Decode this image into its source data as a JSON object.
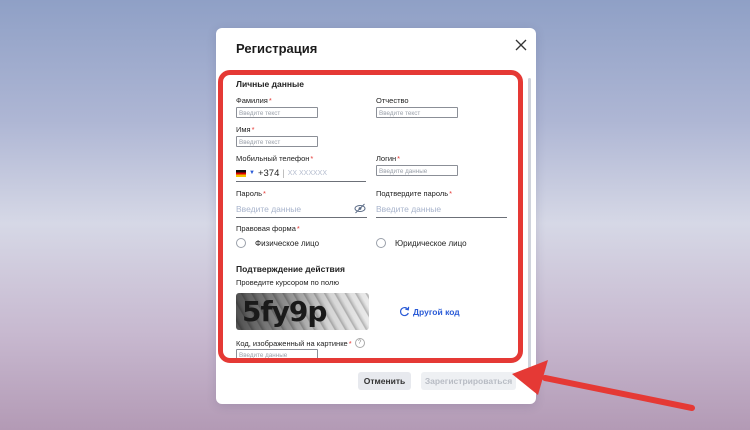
{
  "modal": {
    "title": "Регистрация",
    "section_personal": "Личные данные",
    "section_confirm": "Подтверждение действия",
    "fields": {
      "surname": {
        "label": "Фамилия",
        "required": "*",
        "placeholder": "Введите текст"
      },
      "patronymic": {
        "label": "Отчество",
        "placeholder": "Введите текст"
      },
      "name": {
        "label": "Имя",
        "required": "*",
        "placeholder": "Введите текст"
      },
      "phone": {
        "label": "Мобильный телефон",
        "required": "*",
        "code": "+374",
        "separator": "|",
        "placeholder": "XX XXXXXX"
      },
      "login": {
        "label": "Логин",
        "required": "*",
        "placeholder": "Введите данные"
      },
      "password": {
        "label": "Пароль",
        "required": "*",
        "placeholder": "Введите данные"
      },
      "password_confirm": {
        "label": "Подтвердите пароль",
        "required": "*",
        "placeholder": "Введите данные"
      },
      "legal_form": {
        "label": "Правовая форма",
        "required": "*",
        "options": [
          "Физическое лицо",
          "Юридическое лицо"
        ]
      },
      "captcha_code": {
        "label": "Код, изображенный на картинке",
        "required": "*",
        "help": "?",
        "placeholder": "Введите данные"
      }
    },
    "captcha": {
      "hint": "Проведите курсором по полю",
      "text": "5fy9p",
      "refresh_label": "Другой код"
    },
    "buttons": {
      "cancel": "Отменить",
      "register": "Зарегистрироваться"
    }
  },
  "colors": {
    "accent": "#2a5bd7",
    "highlight": "#e53935",
    "required": "#e53935"
  },
  "icons": {
    "close": "close-icon",
    "flag": "flag-icon",
    "eye": "eye-off-icon",
    "refresh": "refresh-icon",
    "help": "help-icon"
  }
}
